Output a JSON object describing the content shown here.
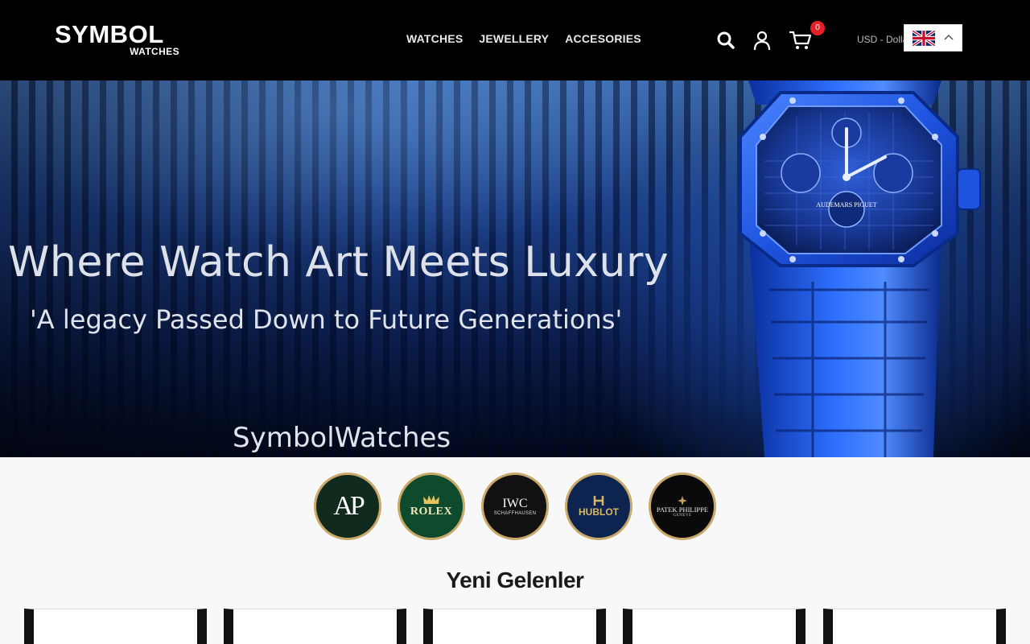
{
  "header": {
    "logo_main": "SYMB",
    "logo_o": "O",
    "logo_end": "L",
    "logo_sub": "WATCHES",
    "nav": [
      "WATCHES",
      "JEWELLERY",
      "ACCESORIES"
    ],
    "cart_count": "0",
    "currency": "USD - Dollar",
    "language_flag": "uk-flag-icon"
  },
  "hero": {
    "title": "Where Watch Art Meets Luxury",
    "subtitle": "'A legacy Passed Down to Future Generations'",
    "brand": "SymbolWatches",
    "watch_dial_text": "AUDEMARS PIGUET"
  },
  "brands": [
    {
      "name": "AP",
      "small": ""
    },
    {
      "name": "ROLEX",
      "small": ""
    },
    {
      "name": "IWC",
      "small": "SCHAFFHAUSEN"
    },
    {
      "name": "HUBLOT",
      "small": ""
    },
    {
      "name": "PATEK PHILIPPE",
      "small": "GENEVE"
    }
  ],
  "new_arrivals": {
    "title": "Yeni Gelenler"
  },
  "colors": {
    "header_bg": "#000000",
    "badge": "#e42127",
    "brand_ring": "#c8a96a"
  }
}
